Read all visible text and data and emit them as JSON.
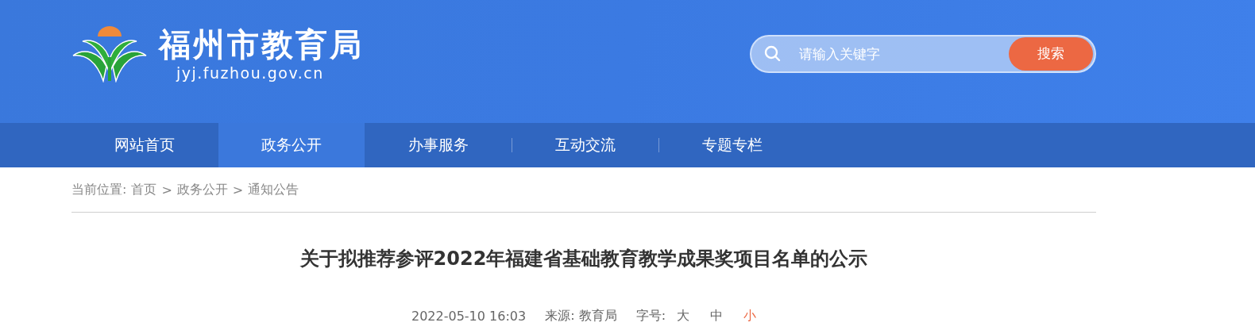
{
  "header": {
    "site_name": "福州市教育局",
    "domain": "jyj.fuzhou.gov.cn",
    "search": {
      "placeholder": "请输入关键字",
      "button": "搜索"
    }
  },
  "nav": [
    {
      "label": "网站首页",
      "selected": false
    },
    {
      "label": "政务公开",
      "selected": true
    },
    {
      "label": "办事服务",
      "selected": false
    },
    {
      "label": "互动交流",
      "selected": false
    },
    {
      "label": "专题专栏",
      "selected": false
    }
  ],
  "breadcrumb": {
    "label": "当前位置:",
    "items": [
      "首页",
      "政务公开",
      "通知公告"
    ],
    "separators": [
      ">",
      ">"
    ]
  },
  "article": {
    "title": "关于拟推荐参评2022年福建省基础教育教学成果奖项目名单的公示",
    "date": "2022-05-10 16:03",
    "source": "来源: 教育局",
    "font_size_label": "字号:",
    "font_sizes": [
      {
        "label": "大",
        "selected": false
      },
      {
        "label": "中",
        "selected": false
      },
      {
        "label": "小",
        "selected": true
      }
    ]
  }
}
